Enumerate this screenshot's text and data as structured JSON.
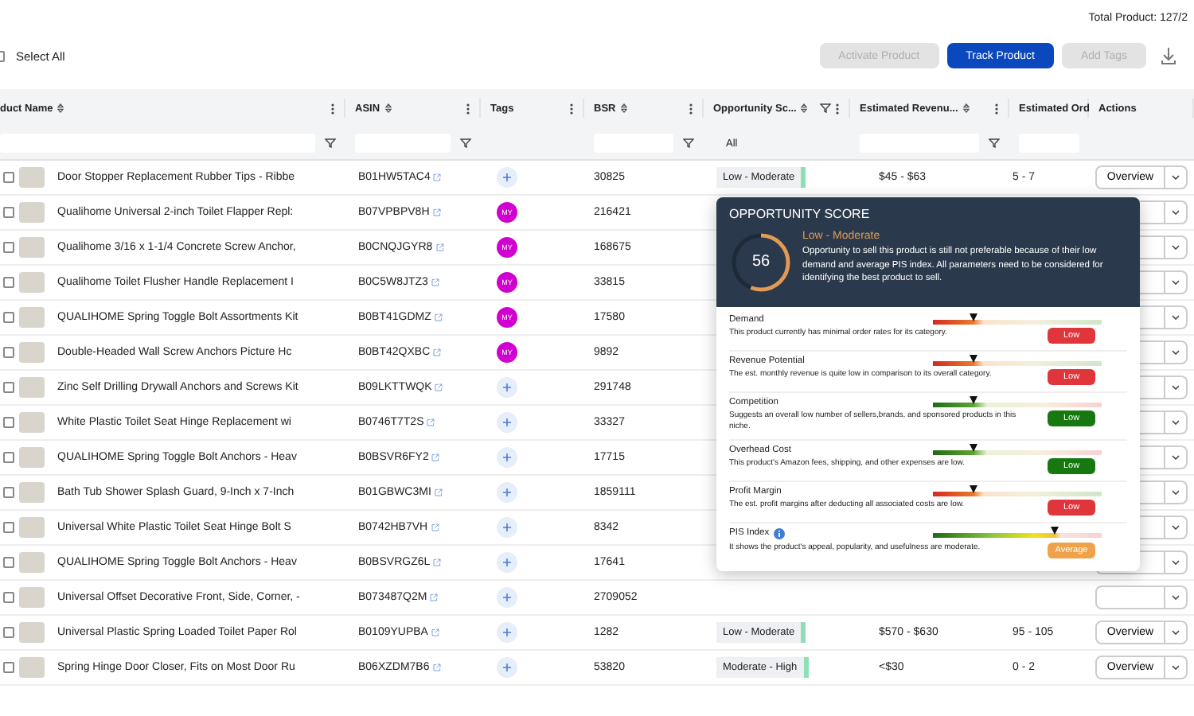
{
  "header": {
    "total": "Total Product: 127/2"
  },
  "toolbar": {
    "select_all": {
      "label": "Select All",
      "checked": false
    },
    "buttons": [
      {
        "label": "Activate Product",
        "disabled": true,
        "primary": false
      },
      {
        "label": "Track Product",
        "disabled": false,
        "primary": true
      },
      {
        "label": "Add Tags",
        "disabled": true,
        "primary": false
      }
    ]
  },
  "table": {
    "columns": [
      {
        "label": "duct Name",
        "sortable": true,
        "header_filter": false,
        "menu": true,
        "filter": {
          "kind": "text"
        }
      },
      {
        "label": "ASIN",
        "sortable": true,
        "header_filter": false,
        "menu": true,
        "filter": {
          "kind": "text"
        }
      },
      {
        "label": "Tags",
        "sortable": false,
        "header_filter": false,
        "menu": true
      },
      {
        "label": "BSR",
        "sortable": true,
        "header_filter": false,
        "menu": true,
        "filter": {
          "kind": "text"
        }
      },
      {
        "label": "Opportunity Sc...",
        "sortable": true,
        "header_filter": true,
        "menu": true,
        "filter": {
          "kind": "select",
          "value": "All"
        }
      },
      {
        "label": "Estimated Revenu...",
        "sortable": true,
        "header_filter": false,
        "menu": true,
        "filter": {
          "kind": "text"
        }
      },
      {
        "label": "Estimated Ord",
        "filter": {
          "kind": "plain"
        }
      },
      {
        "label": "Actions",
        "sortable": false,
        "header_filter": false,
        "menu": false
      }
    ],
    "rows": [
      {
        "checked": false,
        "name": "Door Stopper Replacement Rubber Tips - Ribbe",
        "asin": "B01HW5TAC4",
        "tag": {
          "kind": "add"
        },
        "bsr": "30825",
        "opportunity": {
          "label": "Low - Moderate",
          "color": "#8ee0b4"
        },
        "revenue": "$45 - $63",
        "orders": "5 - 7",
        "action": "Overview"
      },
      {
        "checked": false,
        "name": "Qualihome Universal 2-inch Toilet Flapper Repl:",
        "asin": "B07VPBPV8H",
        "tag": {
          "kind": "label",
          "label": "MY"
        },
        "bsr": "216421"
      },
      {
        "checked": false,
        "name": "Qualihome 3/16 x 1-1/4 Concrete Screw Anchor,",
        "asin": "B0CNQJGYR8",
        "tag": {
          "kind": "label",
          "label": "MY"
        },
        "bsr": "168675"
      },
      {
        "checked": false,
        "name": "Qualihome Toilet Flusher Handle Replacement I",
        "asin": "B0C5W8JTZ3",
        "tag": {
          "kind": "label",
          "label": "MY"
        },
        "bsr": "33815"
      },
      {
        "checked": false,
        "name": "QUALIHOME Spring Toggle Bolt Assortments Kit",
        "asin": "B0BT41GDMZ",
        "tag": {
          "kind": "label",
          "label": "MY"
        },
        "bsr": "17580"
      },
      {
        "checked": false,
        "name": "Double-Headed Wall Screw Anchors Picture Hc",
        "asin": "B0BT42QXBC",
        "tag": {
          "kind": "label",
          "label": "MY"
        },
        "bsr": "9892"
      },
      {
        "checked": false,
        "name": "Zinc Self Drilling Drywall Anchors and Screws Kit",
        "asin": "B09LKTTWQK",
        "tag": {
          "kind": "add"
        },
        "bsr": "291748"
      },
      {
        "checked": false,
        "name": "White Plastic Toilet Seat Hinge Replacement wi",
        "asin": "B0746T7T2S",
        "tag": {
          "kind": "add"
        },
        "bsr": "33327"
      },
      {
        "checked": false,
        "name": "QUALIHOME Spring Toggle Bolt Anchors - Heav",
        "asin": "B0BSVR6FY2",
        "tag": {
          "kind": "add"
        },
        "bsr": "17715"
      },
      {
        "checked": false,
        "name": "Bath Tub Shower Splash Guard, 9-Inch x 7-Inch",
        "asin": "B01GBWC3MI",
        "tag": {
          "kind": "add"
        },
        "bsr": "1859111"
      },
      {
        "checked": false,
        "name": "Universal White Plastic Toilet Seat Hinge Bolt S",
        "asin": "B0742HB7VH",
        "tag": {
          "kind": "add"
        },
        "bsr": "8342"
      },
      {
        "checked": false,
        "name": "QUALIHOME Spring Toggle Bolt Anchors - Heav",
        "asin": "B0BSVRGZ6L",
        "tag": {
          "kind": "add"
        },
        "bsr": "17641"
      },
      {
        "checked": false,
        "name": "Universal Offset Decorative Front, Side, Corner, -",
        "asin": "B073487Q2M",
        "tag": {
          "kind": "add"
        },
        "bsr": "2709052"
      },
      {
        "checked": false,
        "name": "Universal Plastic Spring Loaded Toilet Paper Rol",
        "asin": "B0109YUPBA",
        "tag": {
          "kind": "add"
        },
        "bsr": "1282",
        "opportunity": {
          "label": "Low - Moderate",
          "color": "#8ee0b4"
        },
        "revenue": "$570 - $630",
        "orders": "95 - 105",
        "action": "Overview"
      },
      {
        "checked": false,
        "name": "Spring Hinge Door Closer, Fits on Most Door Ru",
        "asin": "B06XZDM7B6",
        "tag": {
          "kind": "add"
        },
        "bsr": "53820",
        "opportunity": {
          "label": "Moderate - High",
          "color": "#8ee0b4"
        },
        "revenue": "<$30",
        "orders": "0 - 2",
        "action": "Overview"
      }
    ]
  },
  "popover": {
    "title": "OPPORTUNITY SCORE",
    "score": "56",
    "level": 0.56,
    "rating": "Low - Moderate",
    "description": "Opportunity to sell this product is still not preferable because of their low demand and average PIS index. All parameters need to be considered for identifying the best product to sell.",
    "factors": [
      {
        "name": "Demand",
        "info": false,
        "kind": "rising",
        "level": 0.24,
        "description": "This product currently has minimal order rates for its category.",
        "badge": "Low",
        "color": "#e0353b"
      },
      {
        "name": "Revenue Potential",
        "info": false,
        "kind": "rising",
        "level": 0.24,
        "description": "The est. monthly revenue is quite low in comparison to its overall category.",
        "badge": "Low",
        "color": "#e0353b"
      },
      {
        "name": "Competition",
        "info": false,
        "kind": "falling",
        "level": 0.24,
        "description": "Suggests an overall low number of sellers,brands, and sponsored products in this niche.",
        "badge": "Low",
        "color": "#16780f"
      },
      {
        "name": "Overhead Cost",
        "info": false,
        "kind": "falling",
        "level": 0.24,
        "description": "This product's Amazon fees, shipping, and other expenses are low.",
        "badge": "Low",
        "color": "#16780f"
      },
      {
        "name": "Profit Margin",
        "info": false,
        "kind": "rising",
        "level": 0.24,
        "description": "The est. profit margins after deducting all associated costs are low.",
        "badge": "Low",
        "color": "#e0353b"
      },
      {
        "name": "PIS Index",
        "info": true,
        "kind": "index",
        "level": 0.72,
        "description": "It shows the product's appeal, popularity, and usefulness are moderate.",
        "badge": "Average",
        "color": "#f0a24a"
      }
    ]
  }
}
